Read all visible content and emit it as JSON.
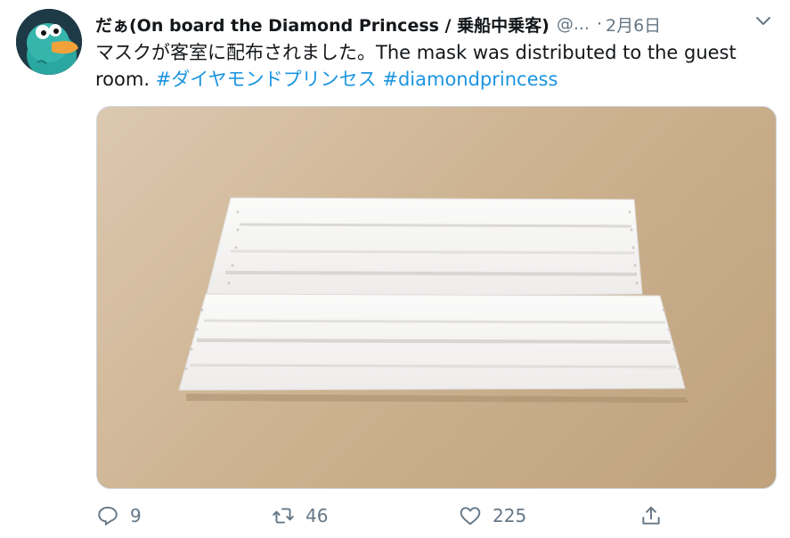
{
  "tweet": {
    "display_name": "だぁ(On board the Diamond Princess / 乗船中乗客)",
    "handle": "@...",
    "separator": "·",
    "date": "2月6日",
    "text_line1": "マスクが客室に配布されました。The mask was distributed to the guest",
    "text_line2_prefix": "room.",
    "hashtags": [
      "#ダイヤモンドプリンセス",
      "#diamondprincess"
    ]
  },
  "actions": {
    "reply_count": "9",
    "retweet_count": "46",
    "like_count": "225"
  },
  "colors": {
    "link": "#1b95e0",
    "secondary": "#657786",
    "text": "#14171a"
  },
  "icons": {
    "avatar": "perry-platypus-avatar",
    "menu": "chevron-down-icon",
    "reply": "reply-icon",
    "retweet": "retweet-icon",
    "like": "heart-icon",
    "share": "share-icon"
  }
}
